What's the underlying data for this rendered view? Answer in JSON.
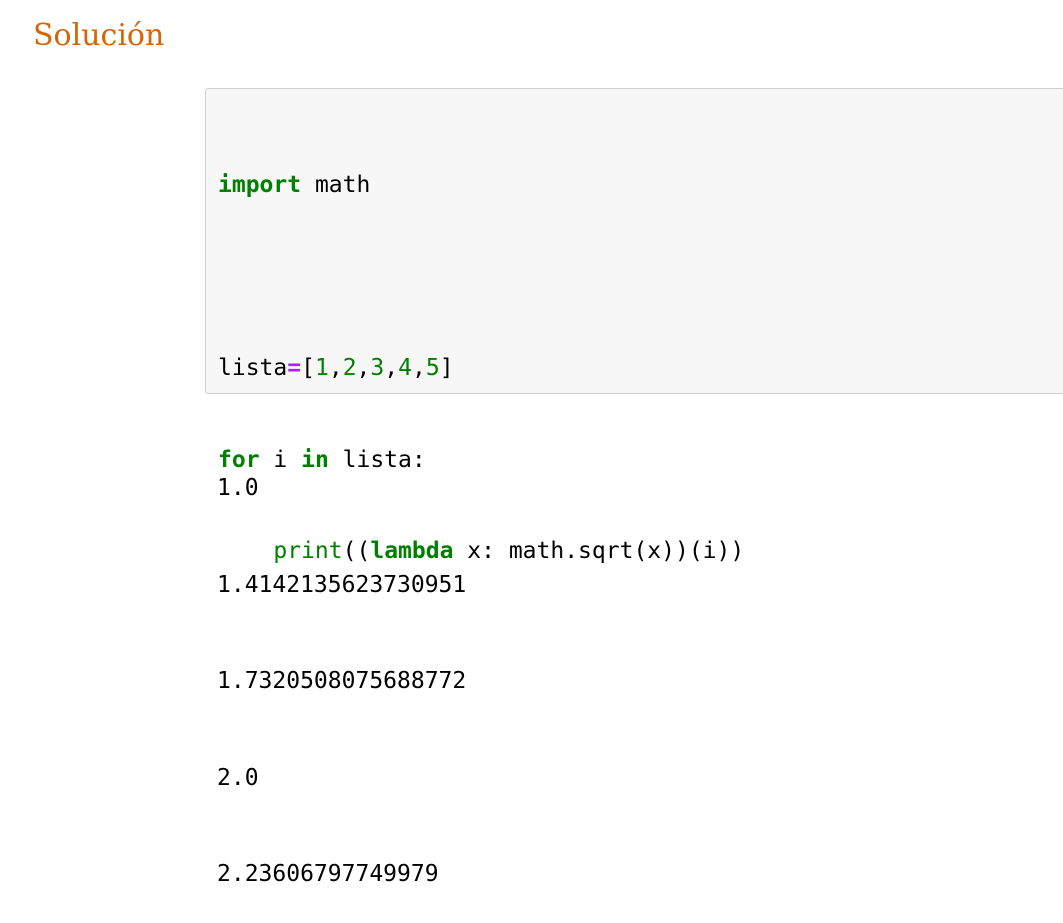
{
  "heading": "Solución",
  "code": {
    "line1": {
      "kw": "import",
      "rest": " math"
    },
    "line3": {
      "var": "lista",
      "eq": "=",
      "open": "[",
      "n1": "1",
      "n2": "2",
      "n3": "3",
      "n4": "4",
      "n5": "5",
      "comma": ",",
      "close": "]"
    },
    "line4": {
      "kw_for": "for",
      "mid": " i ",
      "kw_in": "in",
      "rest": " lista:"
    },
    "line5": {
      "indent": "    ",
      "print": "print",
      "pre": "((",
      "kw_lambda": "lambda",
      "rest": " x: math.sqrt(x))(i))"
    }
  },
  "output": {
    "lines": [
      "1.0",
      "1.4142135623730951",
      "1.7320508075688772",
      "2.0",
      "2.23606797749979"
    ]
  }
}
